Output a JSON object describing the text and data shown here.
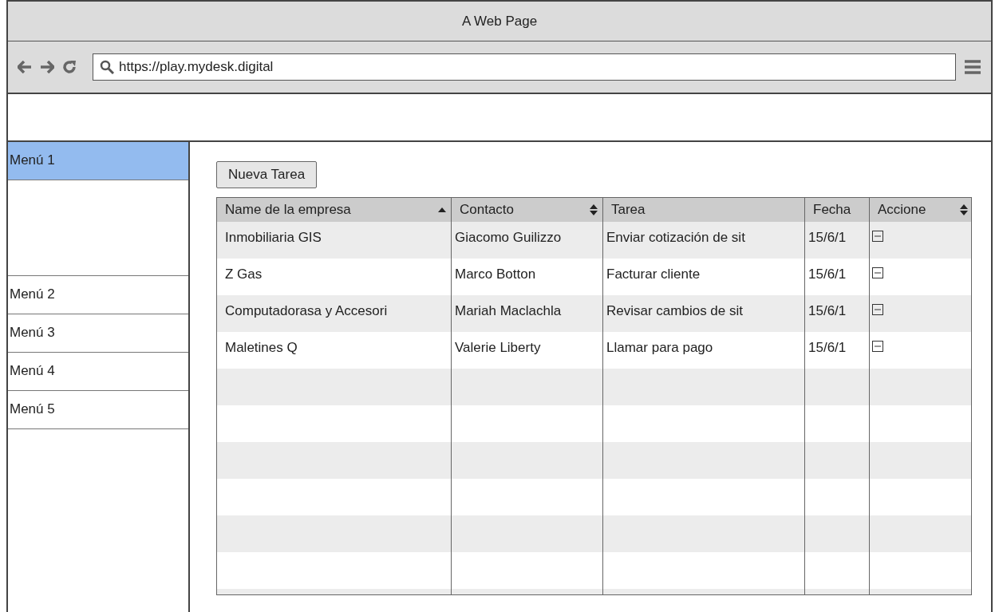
{
  "window": {
    "title": "A Web Page"
  },
  "browser": {
    "url": "https://play.mydesk.digital"
  },
  "sidebar": {
    "items": [
      {
        "label": "Menú 1",
        "selected": true,
        "expanded": true
      },
      {
        "label": "Menú 2",
        "selected": false,
        "expanded": false
      },
      {
        "label": "Menú 3",
        "selected": false,
        "expanded": false
      },
      {
        "label": "Menú 4",
        "selected": false,
        "expanded": false
      },
      {
        "label": "Menú 5",
        "selected": false,
        "expanded": false
      }
    ]
  },
  "new_task_button": "Nueva Tarea",
  "table": {
    "columns": [
      {
        "label": "Name de la empresa",
        "kind": "sorted"
      },
      {
        "label": "Contacto",
        "kind": "sortable"
      },
      {
        "label": "Tarea",
        "kind": "plain"
      },
      {
        "label": "Fecha",
        "kind": "plain"
      },
      {
        "label": "Accione",
        "kind": "sortable"
      }
    ],
    "rows": [
      [
        "Inmobiliaria GIS",
        "Giacomo Guilizzo",
        "Enviar cotización de sit",
        "15/6/1"
      ],
      [
        "Z Gas",
        "Marco Botton",
        "Facturar cliente",
        "15/6/1"
      ],
      [
        "Computadorasa y Accesori",
        "Mariah Maclachla",
        "Revisar cambios de sit",
        "15/6/1"
      ],
      [
        "Maletines Q",
        "Valerie Liberty",
        "Llamar para pago",
        "15/6/1"
      ]
    ]
  }
}
